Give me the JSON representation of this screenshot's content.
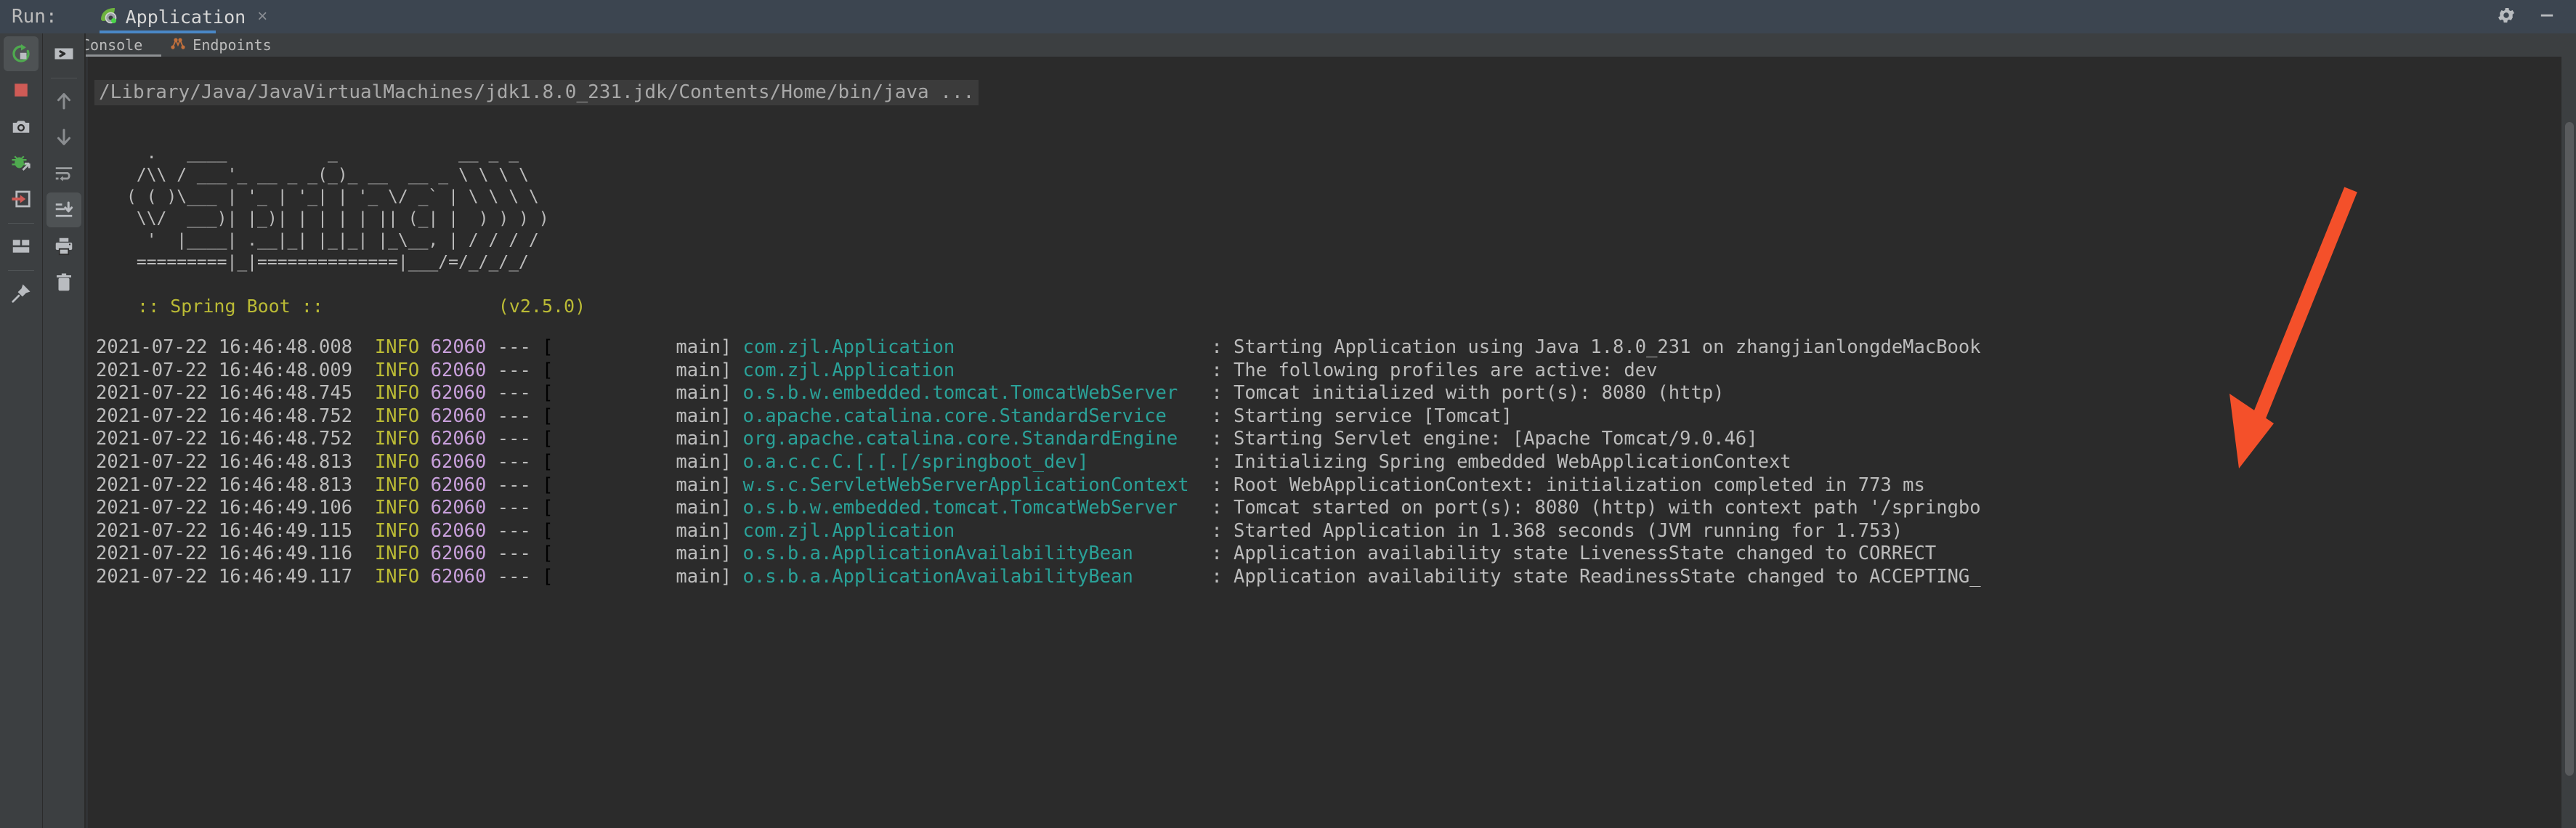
{
  "window": {
    "run_label": "Run:",
    "tab_label": "Application",
    "tab_close_glyph": "×",
    "settings_icon": "gear-icon",
    "minimize_icon": "minimize-icon"
  },
  "subtabs": [
    {
      "label": "Console",
      "icon": "console-chevron-icon",
      "active": true
    },
    {
      "label": "Endpoints",
      "icon": "endpoints-graph-icon",
      "active": false
    }
  ],
  "toolbar_left": [
    {
      "name": "rerun-button",
      "icon": "rerun-circular-arrow-icon",
      "active": true
    },
    {
      "name": "stop-button",
      "icon": "stop-square-icon",
      "active": false
    },
    {
      "name": "screenshot-button",
      "icon": "camera-icon",
      "active": false
    },
    {
      "name": "debug-button",
      "icon": "bug-arrow-icon",
      "active": false
    },
    {
      "name": "attach-button",
      "icon": "enter-arrow-box-icon",
      "active": false
    },
    {
      "name": "layout-button",
      "icon": "layout-panels-icon",
      "active": false
    },
    {
      "name": "pin-button",
      "icon": "pin-icon",
      "active": false
    }
  ],
  "toolbar_right": [
    {
      "name": "expand-console-button",
      "icon": "chevron-right-box-icon",
      "active": false
    },
    {
      "name": "scroll-up-button",
      "icon": "arrow-up-icon",
      "active": false
    },
    {
      "name": "scroll-down-button",
      "icon": "arrow-down-icon",
      "active": false
    },
    {
      "name": "soft-wrap-button",
      "icon": "soft-wrap-icon",
      "active": false
    },
    {
      "name": "scroll-to-end-button",
      "icon": "scroll-to-end-icon",
      "active": true
    },
    {
      "name": "print-button",
      "icon": "printer-icon",
      "active": false
    },
    {
      "name": "clear-all-button",
      "icon": "trash-icon",
      "active": false
    }
  ],
  "console": {
    "command_line": "/Library/Java/JavaVirtualMachines/jdk1.8.0_231.jdk/Contents/Home/bin/java ...",
    "banner_ascii": "  .   ____          _            __ _ _\n /\\\\ / ___'_ __ _ _(_)_ __  __ _ \\ \\ \\ \\\n( ( )\\___ | '_ | '_| | '_ \\/ _` | \\ \\ \\ \\\n \\\\/  ___)| |_)| | | | | || (_| |  ) ) ) )\n  '  |____| .__|_| |_|_| |_\\__, | / / / /\n =========|_|==============|___/=/_/_/_/",
    "banner_title": " :: Spring Boot ::                (v2.5.0)",
    "spring_version": "v2.5.0",
    "log_lines": [
      {
        "timestamp": "2021-07-22 16:46:48.008",
        "level": "INFO",
        "pid": "62060",
        "separator": "---",
        "thread": "           main]",
        "logger": "com.zjl.Application                      ",
        "message": ": Starting Application using Java 1.8.0_231 on zhangjianlongdeMacBook"
      },
      {
        "timestamp": "2021-07-22 16:46:48.009",
        "level": "INFO",
        "pid": "62060",
        "separator": "---",
        "thread": "           main]",
        "logger": "com.zjl.Application                      ",
        "message": ": The following profiles are active: dev"
      },
      {
        "timestamp": "2021-07-22 16:46:48.745",
        "level": "INFO",
        "pid": "62060",
        "separator": "---",
        "thread": "           main]",
        "logger": "o.s.b.w.embedded.tomcat.TomcatWebServer  ",
        "message": ": Tomcat initialized with port(s): 8080 (http)"
      },
      {
        "timestamp": "2021-07-22 16:46:48.752",
        "level": "INFO",
        "pid": "62060",
        "separator": "---",
        "thread": "           main]",
        "logger": "o.apache.catalina.core.StandardService   ",
        "message": ": Starting service [Tomcat]"
      },
      {
        "timestamp": "2021-07-22 16:46:48.752",
        "level": "INFO",
        "pid": "62060",
        "separator": "---",
        "thread": "           main]",
        "logger": "org.apache.catalina.core.StandardEngine  ",
        "message": ": Starting Servlet engine: [Apache Tomcat/9.0.46]"
      },
      {
        "timestamp": "2021-07-22 16:46:48.813",
        "level": "INFO",
        "pid": "62060",
        "separator": "---",
        "thread": "           main]",
        "logger": "o.a.c.c.C.[.[.[/springboot_dev]          ",
        "message": ": Initializing Spring embedded WebApplicationContext"
      },
      {
        "timestamp": "2021-07-22 16:46:48.813",
        "level": "INFO",
        "pid": "62060",
        "separator": "---",
        "thread": "           main]",
        "logger": "w.s.c.ServletWebServerApplicationContext ",
        "message": ": Root WebApplicationContext: initialization completed in 773 ms"
      },
      {
        "timestamp": "2021-07-22 16:46:49.106",
        "level": "INFO",
        "pid": "62060",
        "separator": "---",
        "thread": "           main]",
        "logger": "o.s.b.w.embedded.tomcat.TomcatWebServer  ",
        "message": ": Tomcat started on port(s): 8080 (http) with context path '/springbo"
      },
      {
        "timestamp": "2021-07-22 16:46:49.115",
        "level": "INFO",
        "pid": "62060",
        "separator": "---",
        "thread": "           main]",
        "logger": "com.zjl.Application                      ",
        "message": ": Started Application in 1.368 seconds (JVM running for 1.753)"
      },
      {
        "timestamp": "2021-07-22 16:46:49.116",
        "level": "INFO",
        "pid": "62060",
        "separator": "---",
        "thread": "           main]",
        "logger": "o.s.b.a.ApplicationAvailabilityBean      ",
        "message": ": Application availability state LivenessState changed to CORRECT"
      },
      {
        "timestamp": "2021-07-22 16:46:49.117",
        "level": "INFO",
        "pid": "62060",
        "separator": "---",
        "thread": "           main]",
        "logger": "o.s.b.a.ApplicationAvailabilityBean      ",
        "message": ": Application availability state ReadinessState changed to ACCEPTING_"
      }
    ]
  },
  "annotation": {
    "name": "red-arrow-annotation",
    "color": "#f4502a"
  },
  "colors": {
    "console_bg": "#2b2b2b",
    "titlebar_bg": "#3c4550",
    "toolbar_bg": "#3c3f41",
    "accent_tab": "#4a88c7",
    "level_info": "#bbbb35",
    "pid": "#c9a0dc",
    "logger": "#2aa198",
    "message": "#bcbcbc"
  }
}
